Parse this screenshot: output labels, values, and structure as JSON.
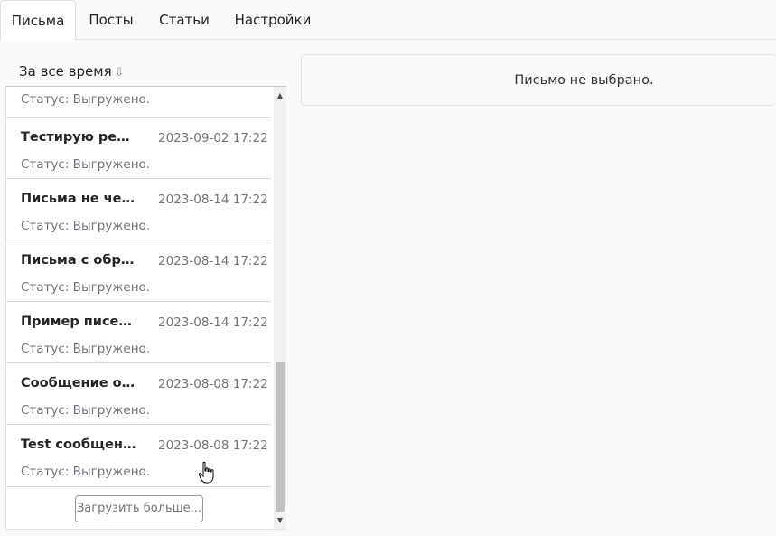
{
  "tabs": [
    {
      "label": "Письма",
      "active": true
    },
    {
      "label": "Посты",
      "active": false
    },
    {
      "label": "Статьи",
      "active": false
    },
    {
      "label": "Настройки",
      "active": false
    }
  ],
  "sort": {
    "label": "За все время",
    "arrow": "⇩"
  },
  "list": {
    "partial_status": "Статус: Выгружено.",
    "items": [
      {
        "title": "Тестирую реги...",
        "date": "2023-09-02 17:22",
        "status": "Статус: Выгружено."
      },
      {
        "title": "Письма не чер...",
        "date": "2023-08-14 17:22",
        "status": "Статус: Выгружено."
      },
      {
        "title": "Письма с обра...",
        "date": "2023-08-14 17:22",
        "status": "Статус: Выгружено."
      },
      {
        "title": "Пример писем ...",
        "date": "2023-08-14 17:22",
        "status": "Статус: Выгружено."
      },
      {
        "title": "Сообщение от ...",
        "date": "2023-08-08 17:22",
        "status": "Статус: Выгружено."
      },
      {
        "title": "Test сообщения",
        "date": "2023-08-08 17:22",
        "status": "Статус: Выгружено."
      }
    ],
    "load_more": "Загрузить больше..."
  },
  "preview": {
    "empty_text": "Письмо не выбрано."
  },
  "icons": {
    "scroll_up": "up-arrow-icon",
    "scroll_down": "down-arrow-icon",
    "cursor": "hand-pointer-icon"
  }
}
